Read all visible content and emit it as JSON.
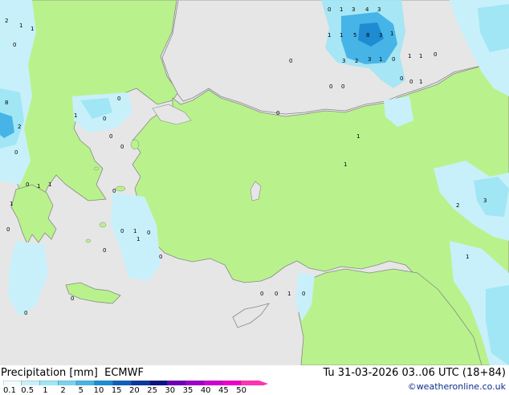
{
  "map": {
    "region": "Turkey / Aegean / Eastern Mediterranean",
    "colors": {
      "sea": "#e6e6e6",
      "land": "#b9f28c",
      "coast": "#888888"
    },
    "point_values": [
      {
        "text": "0"
      },
      {
        "text": "1"
      },
      {
        "text": "3"
      },
      {
        "text": "4"
      },
      {
        "text": "3"
      },
      {
        "text": "1"
      },
      {
        "text": "1"
      },
      {
        "text": "5"
      },
      {
        "text": "8"
      },
      {
        "text": "3"
      },
      {
        "text": "1"
      },
      {
        "text": "3"
      },
      {
        "text": "2"
      },
      {
        "text": "3"
      },
      {
        "text": "1"
      },
      {
        "text": "0"
      },
      {
        "text": "0"
      },
      {
        "text": "0"
      },
      {
        "text": "0"
      },
      {
        "text": "1"
      },
      {
        "text": "1"
      },
      {
        "text": "0"
      },
      {
        "text": "0"
      },
      {
        "text": "0"
      },
      {
        "text": "1"
      },
      {
        "text": "2"
      },
      {
        "text": "1"
      },
      {
        "text": "1"
      },
      {
        "text": "0"
      },
      {
        "text": "8"
      },
      {
        "text": "2"
      },
      {
        "text": "0"
      },
      {
        "text": "1"
      },
      {
        "text": "0"
      },
      {
        "text": "1"
      },
      {
        "text": "1"
      },
      {
        "text": "0"
      },
      {
        "text": "0"
      },
      {
        "text": "0"
      },
      {
        "text": "1"
      },
      {
        "text": "0"
      },
      {
        "text": "0"
      },
      {
        "text": "0"
      },
      {
        "text": "0"
      },
      {
        "text": "0"
      },
      {
        "text": "0"
      },
      {
        "text": "0"
      },
      {
        "text": "0"
      },
      {
        "text": "0"
      },
      {
        "text": "0"
      },
      {
        "text": "1"
      },
      {
        "text": "2"
      },
      {
        "text": "3"
      },
      {
        "text": "1"
      },
      {
        "text": "1"
      },
      {
        "text": "1"
      },
      {
        "text": "1"
      },
      {
        "text": "0"
      },
      {
        "text": "0"
      },
      {
        "text": "1"
      },
      {
        "text": "0"
      }
    ]
  },
  "footer": {
    "title_left": "Precipitation [mm]  ECMWF",
    "title_right": "Tu 31-03-2026 03..06 UTC (18+84)",
    "copyright": "©weatheronline.co.uk"
  },
  "legend": {
    "ticks": [
      "0.1",
      "0.5",
      "1",
      "2",
      "5",
      "10",
      "15",
      "20",
      "25",
      "30",
      "35",
      "40",
      "45",
      "50"
    ],
    "colors": [
      "#f0fcff",
      "#c8f0fa",
      "#a0e6f5",
      "#78d2f0",
      "#46b4e6",
      "#1e8cd2",
      "#0f5fbe",
      "#0a37a0",
      "#0a1482",
      "#6e00b4",
      "#a000c8",
      "#d200d2",
      "#f000c8",
      "#ff32b4"
    ]
  }
}
